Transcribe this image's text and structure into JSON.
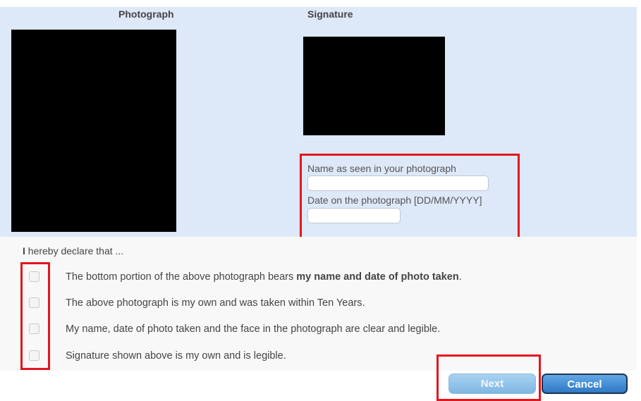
{
  "upload": {
    "photograph_title": "Photograph",
    "signature_title": "Signature",
    "name_label": "Name as seen in your photograph",
    "name_value": "",
    "date_label": "Date on the photograph [DD/MM/YYYY]",
    "date_value": ""
  },
  "declaration": {
    "heading_prefix": "I",
    "heading_rest": " hereby declare that ...",
    "items": [
      {
        "text": "The bottom portion of the above photograph bears ",
        "bold": "my name and date of photo taken",
        "tail": ".",
        "checked": false
      },
      {
        "text": "The above photograph is my own and was taken within Ten Years.",
        "bold": "",
        "tail": "",
        "checked": false
      },
      {
        "text": "My name, date of photo taken and the face in the photograph are clear and legible.",
        "bold": "",
        "tail": "",
        "checked": false
      },
      {
        "text": "Signature shown above is my own and is legible.",
        "bold": "",
        "tail": "",
        "checked": false
      }
    ]
  },
  "buttons": {
    "next_label": "Next",
    "cancel_label": "Cancel"
  },
  "colors": {
    "panel_bg": "#dde8f8",
    "highlight": "#e3161e",
    "cancel_button": "#2f79c6"
  }
}
